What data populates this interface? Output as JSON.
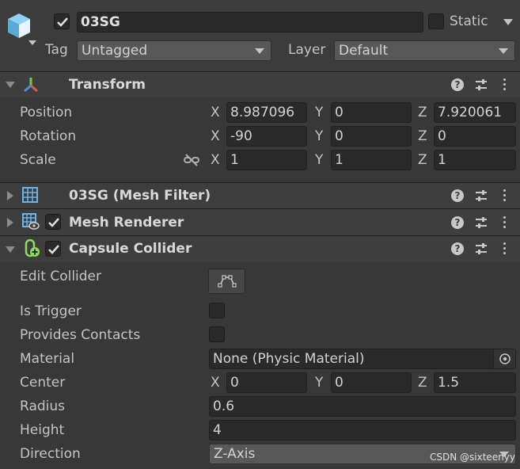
{
  "gameobject": {
    "active": true,
    "name": "03SG",
    "static_label": "Static",
    "static_checked": false,
    "tag_label": "Tag",
    "tag_value": "Untagged",
    "layer_label": "Layer",
    "layer_value": "Default"
  },
  "transform": {
    "title": "Transform",
    "position_label": "Position",
    "rotation_label": "Rotation",
    "scale_label": "Scale",
    "axis_x": "X",
    "axis_y": "Y",
    "axis_z": "Z",
    "position": {
      "x": "8.987096",
      "y": "0",
      "z": "7.920061"
    },
    "rotation": {
      "x": "-90",
      "y": "0",
      "z": "0"
    },
    "scale": {
      "x": "1",
      "y": "1",
      "z": "1"
    }
  },
  "mesh_filter": {
    "title": "03SG (Mesh Filter)"
  },
  "mesh_renderer": {
    "title": "Mesh Renderer",
    "enabled": true
  },
  "capsule_collider": {
    "title": "Capsule Collider",
    "enabled": true,
    "edit_collider_label": "Edit Collider",
    "is_trigger_label": "Is Trigger",
    "is_trigger": false,
    "provides_contacts_label": "Provides Contacts",
    "provides_contacts": false,
    "material_label": "Material",
    "material_value": "None (Physic Material)",
    "center_label": "Center",
    "center": {
      "x": "0",
      "y": "0",
      "z": "1.5"
    },
    "radius_label": "Radius",
    "radius_value": "0.6",
    "height_label": "Height",
    "height_value": "4",
    "direction_label": "Direction",
    "direction_value": "Z-Axis"
  },
  "watermark": "CSDN @sixteenyy",
  "colors": {
    "background": "#383838",
    "header": "#3e3e3e",
    "field": "#2a2a2a",
    "dropdown": "#585858",
    "transform_icon_red": "#e05a4a",
    "transform_icon_green": "#7ec44a",
    "transform_icon_blue": "#4a8ce0",
    "collider_icon_green": "#8edc5a"
  }
}
